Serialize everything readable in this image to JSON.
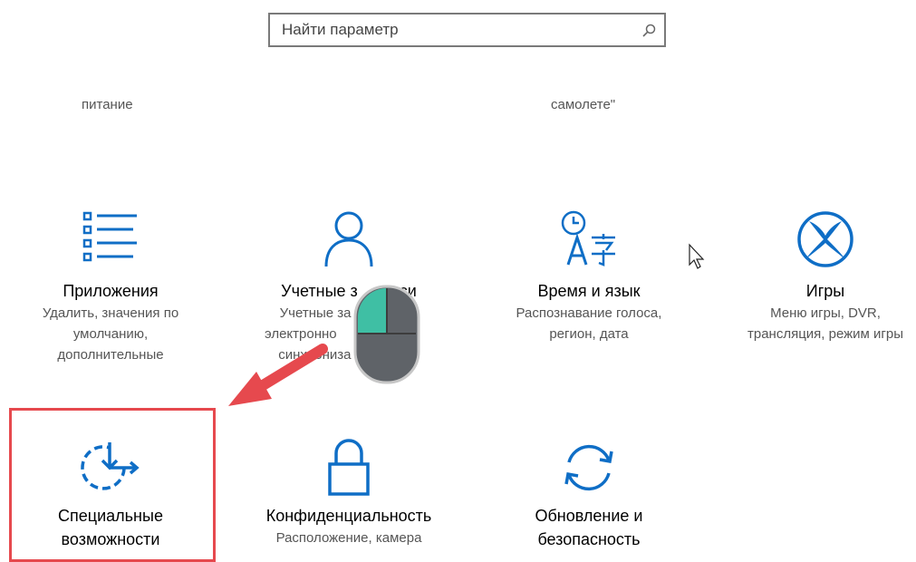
{
  "search": {
    "placeholder": "Найти параметр",
    "icon": "search-icon"
  },
  "fragments": {
    "left": "питание",
    "right": "самолете\""
  },
  "tiles": [
    {
      "title": "Приложения",
      "desc1": "Удалить, значения по",
      "desc2": "умолчанию,",
      "desc3": "дополнительные",
      "icon": "apps-list-icon"
    },
    {
      "title": "Учетные записи",
      "desc1": "Учетные записи, эл. почта, синхронизация, работа, семья",
      "desc2": "",
      "desc3": "",
      "icon": "person-icon"
    },
    {
      "title": "Время и язык",
      "desc1": "Распознавание голоса,",
      "desc2": "регион, дата",
      "desc3": "",
      "icon": "time-language-icon"
    },
    {
      "title": "Игры",
      "desc1": "Меню игры, DVR,",
      "desc2": "трансляция, режим игры",
      "desc3": "",
      "icon": "xbox-icon"
    },
    {
      "title": "Специальные",
      "desc1": "возможности",
      "desc2": "",
      "desc3": "",
      "icon": "accessibility-icon"
    },
    {
      "title": "Конфиденциальность",
      "desc1": "Расположение, камера",
      "desc2": "",
      "desc3": "",
      "icon": "lock-icon"
    },
    {
      "title": "Обновление и",
      "desc1": "безопасность",
      "desc2": "",
      "desc3": "",
      "icon": "update-sync-icon"
    }
  ],
  "tiles_visible_text": {
    "accounts_title": "Учетные з",
    "accounts_title_tail": "си",
    "accounts_desc1": "Учетные за",
    "accounts_desc1_tail": "ес",
    "accounts_desc2": "электронно",
    "accounts_desc2_tail": "",
    "accounts_desc3": "синхрониза",
    "accounts_desc3_tail": "ота,"
  },
  "colors": {
    "accent": "#0f6ec6",
    "highlight": "#e6494e",
    "arrow": "#e6494e"
  }
}
